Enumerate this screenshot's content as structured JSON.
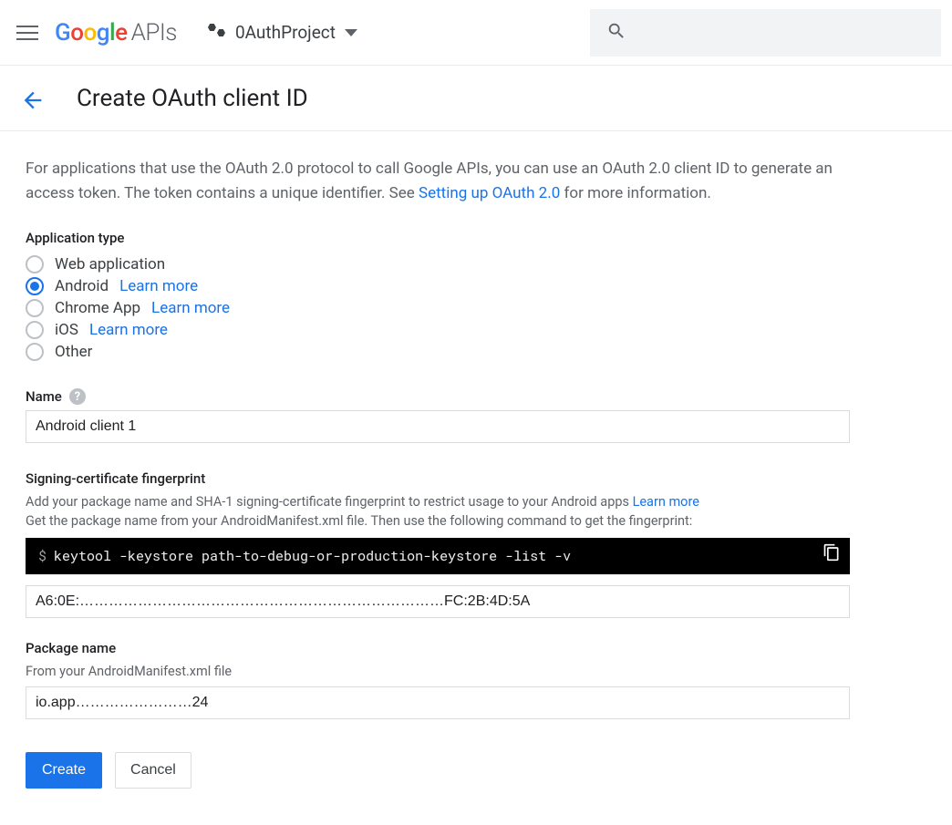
{
  "header": {
    "logo_text": "APIs",
    "project_name": "0AuthProject"
  },
  "subheader": {
    "title": "Create OAuth client ID"
  },
  "intro": {
    "text_before_link": "For applications that use the OAuth 2.0 protocol to call Google APIs, you can use an OAuth 2.0 client ID to generate an access token. The token contains a unique identifier. See ",
    "link_text": "Setting up OAuth 2.0",
    "text_after_link": " for more information."
  },
  "app_type": {
    "label": "Application type",
    "options": [
      {
        "label": "Web application",
        "selected": false,
        "learn_more": null
      },
      {
        "label": "Android",
        "selected": true,
        "learn_more": "Learn more"
      },
      {
        "label": "Chrome App",
        "selected": false,
        "learn_more": "Learn more"
      },
      {
        "label": "iOS",
        "selected": false,
        "learn_more": "Learn more"
      },
      {
        "label": "Other",
        "selected": false,
        "learn_more": null
      }
    ]
  },
  "name_field": {
    "label": "Name",
    "value": "Android client 1"
  },
  "signing": {
    "label": "Signing-certificate fingerprint",
    "desc1_before_link": "Add your package name and SHA-1 signing-certificate fingerprint to restrict usage to your Android apps ",
    "desc1_link": "Learn more",
    "desc2": "Get the package name from your AndroidManifest.xml file. Then use the following command to get the fingerprint:",
    "terminal_cmd": "keytool -keystore path-to-debug-or-production-keystore -list -v",
    "sha1_value": "A6:0E:…………………………………………………………………FC:2B:4D:5A"
  },
  "package": {
    "label": "Package name",
    "desc": "From your AndroidManifest.xml file",
    "value": "io.app……………………24"
  },
  "buttons": {
    "create": "Create",
    "cancel": "Cancel"
  }
}
